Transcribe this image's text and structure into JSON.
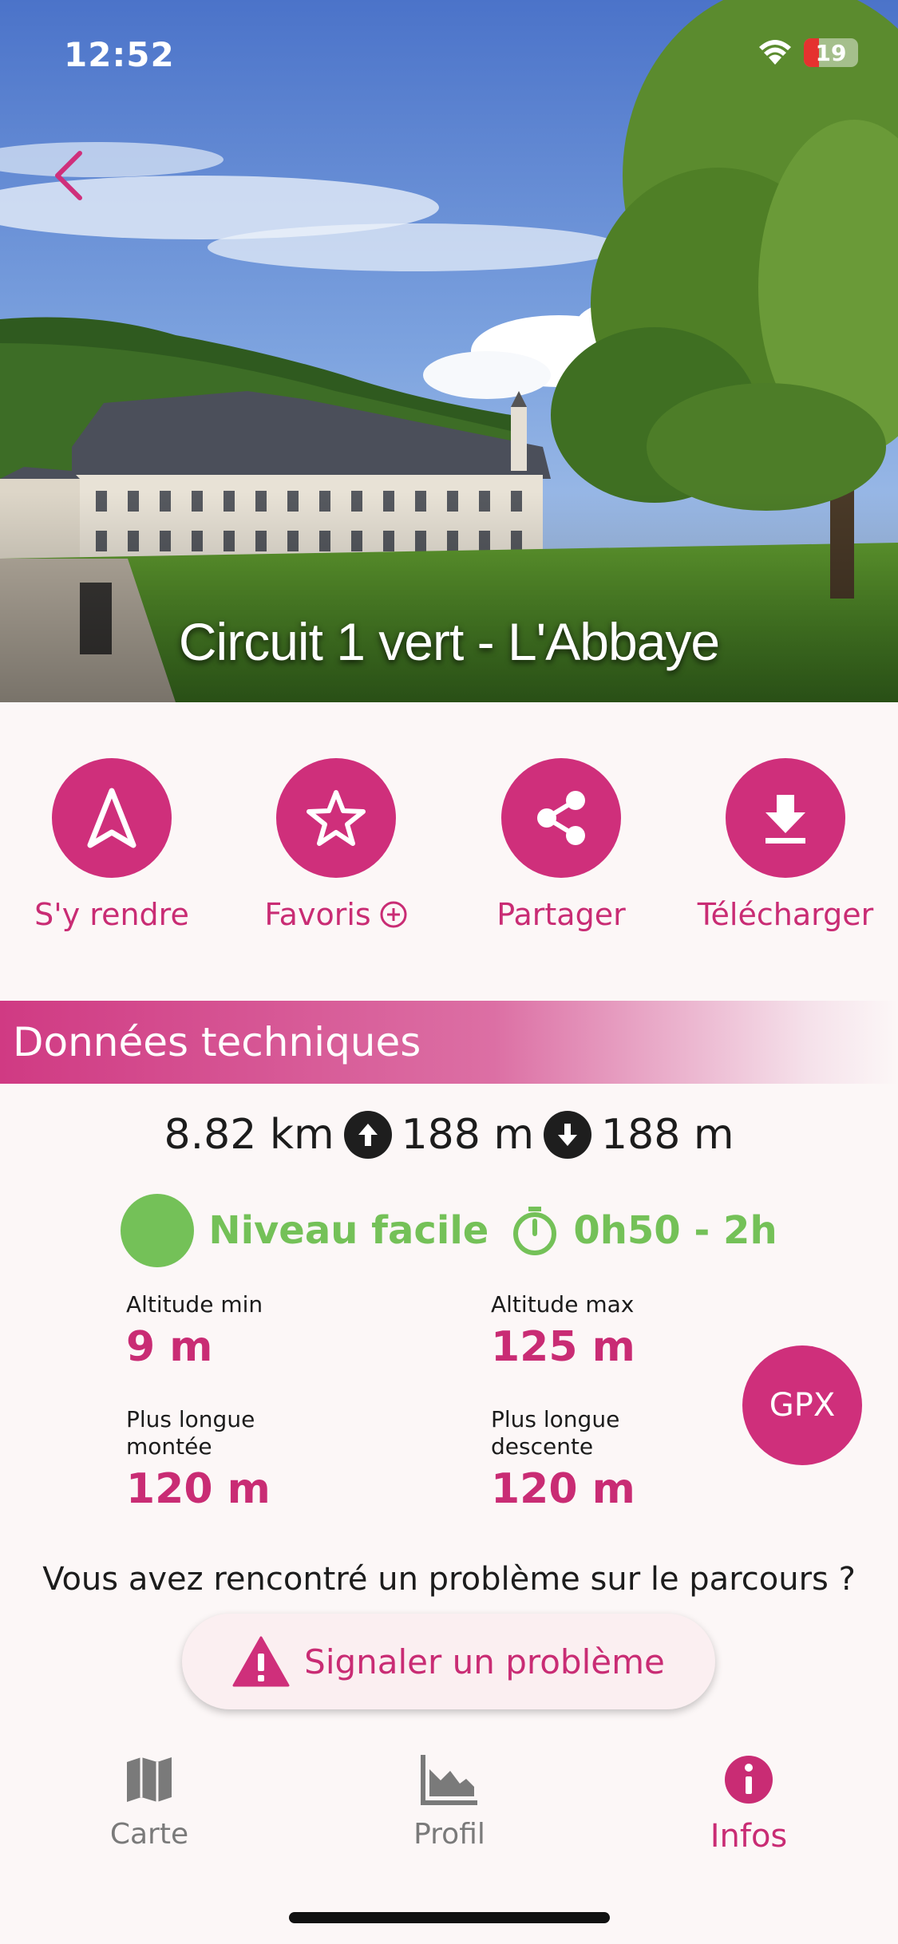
{
  "status_bar": {
    "time": "12:52",
    "battery_level": "19",
    "battery_color": "#e5322f"
  },
  "hero": {
    "title": "Circuit 1 vert - L'Abbaye"
  },
  "actions": [
    {
      "label": "S'y rendre",
      "icon": "navigate-arrow-icon"
    },
    {
      "label": "Favoris",
      "icon": "star-icon",
      "badge_icon": "plus-circle-icon"
    },
    {
      "label": "Partager",
      "icon": "share-icon"
    },
    {
      "label": "Télécharger",
      "icon": "download-icon"
    }
  ],
  "section": {
    "title": "Données techniques"
  },
  "summary": {
    "distance": "8.82 km",
    "ascent": "188 m",
    "descent": "188 m"
  },
  "difficulty": {
    "level": "Niveau facile",
    "duration": "0h50 - 2h",
    "color": "#74c158"
  },
  "metrics": {
    "alt_min": {
      "label": "Altitude min",
      "value": "9 m"
    },
    "alt_max": {
      "label": "Altitude max",
      "value": "125 m"
    },
    "longest_climb": {
      "label": "Plus longue montée",
      "value": "120 m"
    },
    "longest_descent": {
      "label": "Plus longue descente",
      "value": "120 m"
    }
  },
  "gpx": {
    "label": "GPX"
  },
  "problem": {
    "question": "Vous avez rencontré un problème sur le parcours ?",
    "button": "Signaler un problème"
  },
  "bottom_nav": [
    {
      "label": "Carte",
      "icon": "map-icon",
      "active": false
    },
    {
      "label": "Profil",
      "icon": "elevation-chart-icon",
      "active": false
    },
    {
      "label": "Infos",
      "icon": "info-icon",
      "active": true
    }
  ],
  "colors": {
    "accent": "#cf2f7b",
    "accent_text": "#c92c74",
    "background": "#fcf7f7",
    "inactive": "#7a7a7a"
  }
}
